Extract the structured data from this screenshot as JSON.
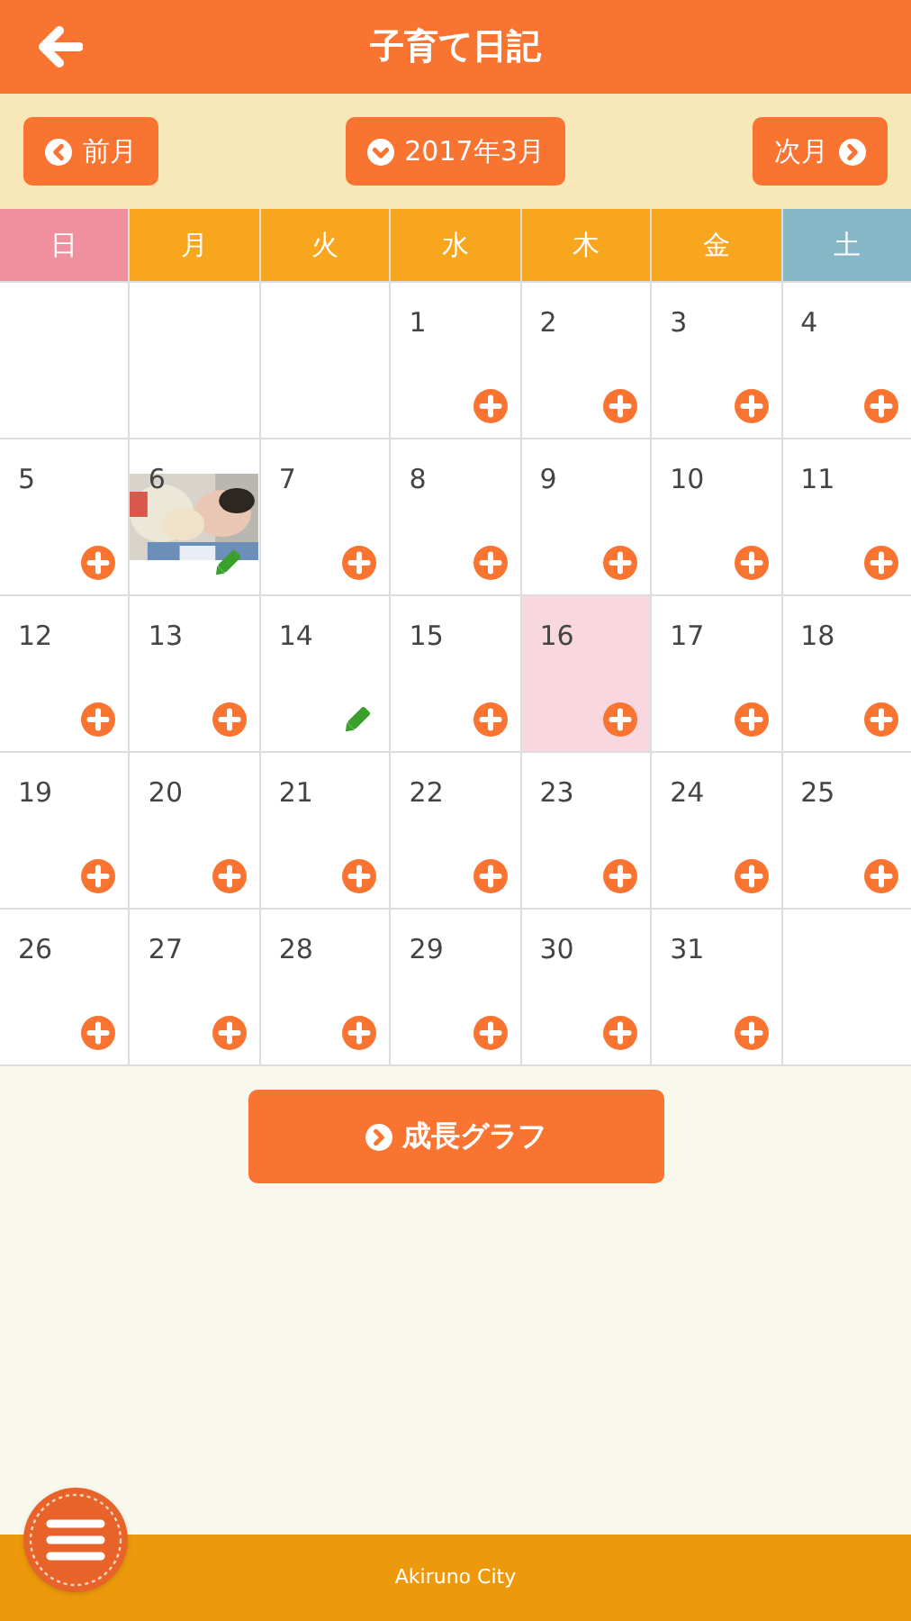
{
  "header": {
    "title": "子育て日記"
  },
  "nav": {
    "prev": "前月",
    "current": "2017年3月",
    "next": "次月"
  },
  "weekdays": [
    {
      "label": "日",
      "color": "#f0909f"
    },
    {
      "label": "月",
      "color": "#f9a61f"
    },
    {
      "label": "火",
      "color": "#f9a61f"
    },
    {
      "label": "水",
      "color": "#f9a61f"
    },
    {
      "label": "木",
      "color": "#f9a61f"
    },
    {
      "label": "金",
      "color": "#f9a61f"
    },
    {
      "label": "土",
      "color": "#86b7c6"
    }
  ],
  "weeks": [
    [
      {
        "kind": "blank"
      },
      {
        "kind": "blank"
      },
      {
        "kind": "blank"
      },
      {
        "kind": "add",
        "day": "1",
        "photo": false,
        "selected": false
      },
      {
        "kind": "add",
        "day": "2",
        "photo": false,
        "selected": false
      },
      {
        "kind": "add",
        "day": "3",
        "photo": false,
        "selected": false
      },
      {
        "kind": "add",
        "day": "4",
        "photo": false,
        "selected": false
      }
    ],
    [
      {
        "kind": "add",
        "day": "5",
        "photo": false,
        "selected": false
      },
      {
        "kind": "edit",
        "day": "6",
        "photo": true,
        "selected": false
      },
      {
        "kind": "add",
        "day": "7",
        "photo": false,
        "selected": false
      },
      {
        "kind": "add",
        "day": "8",
        "photo": false,
        "selected": false
      },
      {
        "kind": "add",
        "day": "9",
        "photo": false,
        "selected": false
      },
      {
        "kind": "add",
        "day": "10",
        "photo": false,
        "selected": false
      },
      {
        "kind": "add",
        "day": "11",
        "photo": false,
        "selected": false
      }
    ],
    [
      {
        "kind": "add",
        "day": "12",
        "photo": false,
        "selected": false
      },
      {
        "kind": "add",
        "day": "13",
        "photo": false,
        "selected": false
      },
      {
        "kind": "edit",
        "day": "14",
        "photo": false,
        "selected": false
      },
      {
        "kind": "add",
        "day": "15",
        "photo": false,
        "selected": false
      },
      {
        "kind": "add",
        "day": "16",
        "photo": false,
        "selected": true
      },
      {
        "kind": "add",
        "day": "17",
        "photo": false,
        "selected": false
      },
      {
        "kind": "add",
        "day": "18",
        "photo": false,
        "selected": false
      }
    ],
    [
      {
        "kind": "add",
        "day": "19",
        "photo": false,
        "selected": false
      },
      {
        "kind": "add",
        "day": "20",
        "photo": false,
        "selected": false
      },
      {
        "kind": "add",
        "day": "21",
        "photo": false,
        "selected": false
      },
      {
        "kind": "add",
        "day": "22",
        "photo": false,
        "selected": false
      },
      {
        "kind": "add",
        "day": "23",
        "photo": false,
        "selected": false
      },
      {
        "kind": "add",
        "day": "24",
        "photo": false,
        "selected": false
      },
      {
        "kind": "add",
        "day": "25",
        "photo": false,
        "selected": false
      }
    ],
    [
      {
        "kind": "add",
        "day": "26",
        "photo": false,
        "selected": false
      },
      {
        "kind": "add",
        "day": "27",
        "photo": false,
        "selected": false
      },
      {
        "kind": "add",
        "day": "28",
        "photo": false,
        "selected": false
      },
      {
        "kind": "add",
        "day": "29",
        "photo": false,
        "selected": false
      },
      {
        "kind": "add",
        "day": "30",
        "photo": false,
        "selected": false
      },
      {
        "kind": "add",
        "day": "31",
        "photo": false,
        "selected": false
      },
      {
        "kind": "blank"
      }
    ]
  ],
  "growth_button": "成長グラフ",
  "footer": {
    "text": "Akiruno City"
  }
}
